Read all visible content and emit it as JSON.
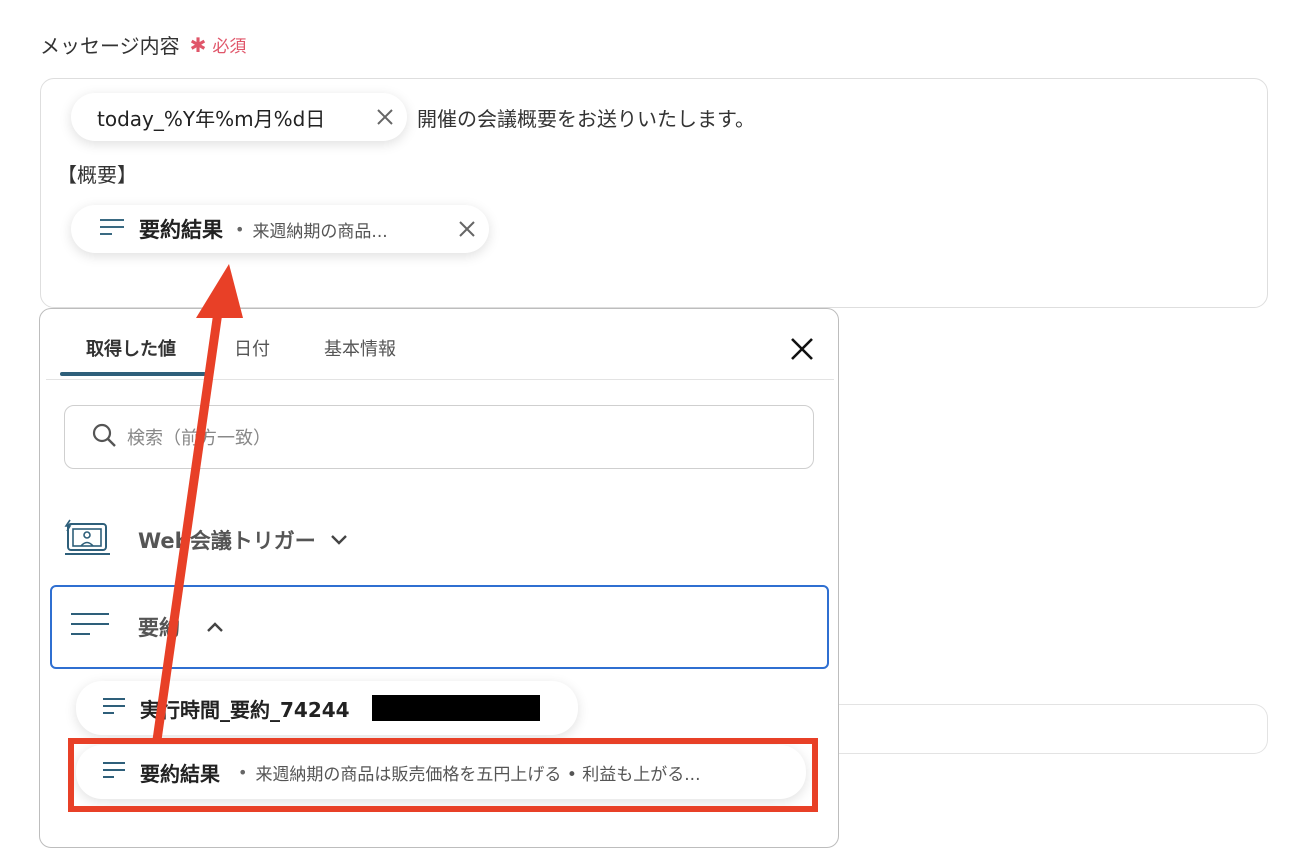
{
  "field": {
    "label": "メッセージ内容",
    "required_star": "✱",
    "required_text": "必須"
  },
  "editor": {
    "date_chip": "today_%Y年%m月%d日",
    "line1_text": "開催の会議概要をお送りいたします。",
    "line2_text": "【概要】",
    "summary_chip": {
      "title": "要約結果",
      "preview": "来週納期の商品..."
    }
  },
  "dropdown": {
    "tabs": [
      "取得した値",
      "日付",
      "基本情報"
    ],
    "active_tab": "取得した値",
    "search_placeholder": "検索（前方一致）",
    "group_title": "Web会議トリガー",
    "summary_group_title": "要約",
    "items": [
      {
        "title": "実行時間_要約_74244"
      },
      {
        "title": "要約結果",
        "preview": "来週納期の商品は販売価格を五円上げる • 利益も上がる..."
      }
    ]
  },
  "colors": {
    "required": "#e0566a",
    "tab_underline": "#2e5f7a",
    "selection_border": "#2f6fd1",
    "annotation": "#e84027"
  }
}
